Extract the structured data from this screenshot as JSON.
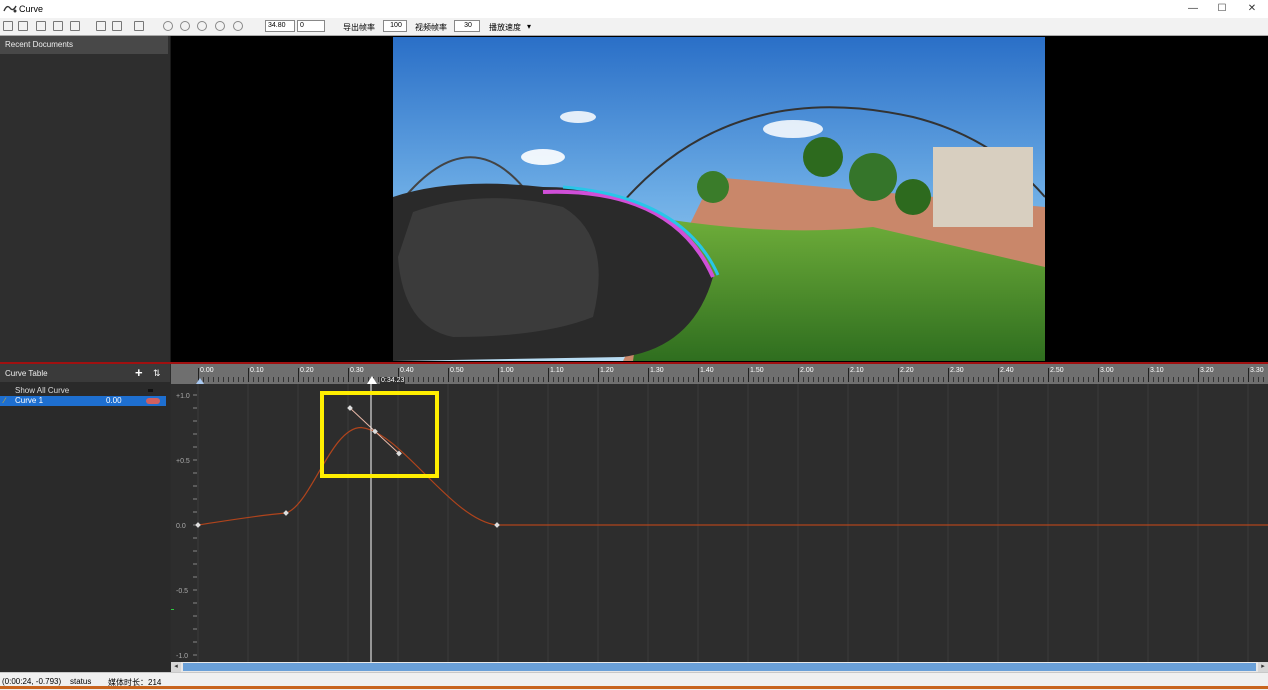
{
  "window": {
    "title": "Curve",
    "minimize_label": "—",
    "maximize_label": "☐",
    "close_label": "✕"
  },
  "toolbar": {
    "time_value": "34.80",
    "frame_value": "0",
    "export_rate_label": "导出帧率",
    "export_rate_value": "100",
    "video_rate_label": "视频帧率",
    "video_rate_value": "30",
    "play_speed_label": "播放速度",
    "play_speed_arrow": "▾"
  },
  "recent_documents": {
    "header": "Recent Documents"
  },
  "curve_table": {
    "title": "Curve Table",
    "add_label": "+",
    "sort_label": "⇅",
    "show_all_label": "Show All Curve",
    "curves": [
      {
        "name": "Curve 1",
        "value": "0.00"
      }
    ],
    "accent_color": "#1e6fd0"
  },
  "timeline": {
    "ruler_ticks": [
      "0.00",
      "0.10",
      "0.20",
      "0.30",
      "0.40",
      "0.50",
      "1.00",
      "1.10",
      "1.20",
      "1.30",
      "1.40",
      "1.50",
      "2.00",
      "2.10",
      "2.20",
      "2.30",
      "2.40",
      "2.50",
      "3.00",
      "3.10",
      "3.20",
      "3.30"
    ],
    "playhead_label": "0:34.23",
    "y_labels": [
      "+1.0",
      "+0.5",
      "0.0",
      "-0.5",
      "-1.0"
    ],
    "curve_color": "#b0441c",
    "highlight_color": "#ffee00"
  },
  "status": {
    "coords": "(0:00:24, -0.793)",
    "status_text": "status",
    "media_duration": "媒体时长：214"
  }
}
